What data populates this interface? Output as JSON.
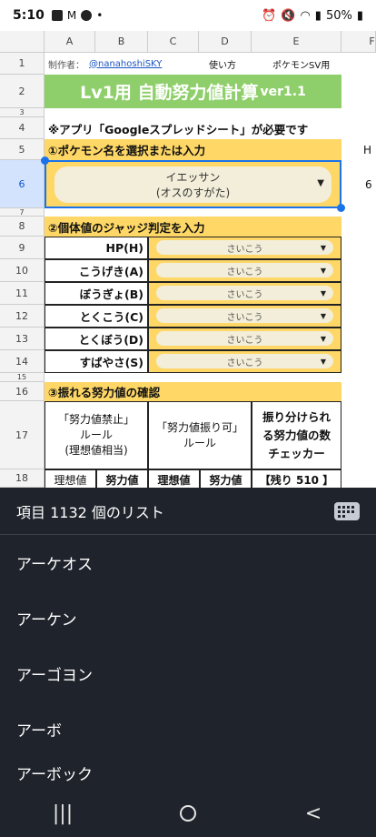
{
  "status": {
    "time": "5:10",
    "battery": "50%"
  },
  "columns": [
    "A",
    "B",
    "C",
    "D",
    "E"
  ],
  "rows": [
    "1",
    "2",
    "3",
    "4",
    "5",
    "6",
    "7",
    "8",
    "9",
    "10",
    "11",
    "12",
    "13",
    "14",
    "15",
    "16",
    "17",
    "18"
  ],
  "header": {
    "author_label": "制作者：",
    "author_link": "@nanahoshiSKY",
    "howto": "使い方",
    "game": "ポケモンSV用",
    "title": "Lv1用 自動努力値計算",
    "title_version": "ver1.1",
    "requirement": "※アプリ「Googleスプレッドシート」が必要です"
  },
  "section1": {
    "title": "①ポケモン名を選択または入力",
    "pokemon_line1": "イエッサン",
    "pokemon_line2": "(オスのすがた)",
    "side_h": "H",
    "side_6": "6"
  },
  "section2": {
    "title": "②個体値のジャッジ判定を入力",
    "stats": [
      {
        "label": "HP(H)",
        "judge": "さいこう"
      },
      {
        "label": "こうげき(A)",
        "judge": "さいこう"
      },
      {
        "label": "ぼうぎょ(B)",
        "judge": "さいこう"
      },
      {
        "label": "とくこう(C)",
        "judge": "さいこう"
      },
      {
        "label": "とくぼう(D)",
        "judge": "さいこう"
      },
      {
        "label": "すばやさ(S)",
        "judge": "さいこう"
      }
    ]
  },
  "section3": {
    "title": "③振れる努力値の確認",
    "col1_line1": "「努力値禁止」",
    "col1_line2": "ルール",
    "col1_line3": "(理想値相当)",
    "col2_line1": "「努力値振り可」",
    "col2_line2": "ルール",
    "col3_line1": "振り分けられ",
    "col3_line2": "る努力値の数",
    "col3_line3": "チェッカー",
    "sub1": "理想値",
    "sub2": "努力値",
    "sub3": "理想値",
    "sub4": "努力値",
    "sub5": "【残り 510 】"
  },
  "list_panel": {
    "title": "項目 1132 個のリスト",
    "items": [
      "アーケオス",
      "アーケン",
      "アーゴヨン",
      "アーボ",
      "アーボック"
    ]
  },
  "colors": {
    "yellow": "#fed766",
    "green": "#8fcf6b",
    "selection": "#1a73e8",
    "panel": "#1f232b"
  }
}
